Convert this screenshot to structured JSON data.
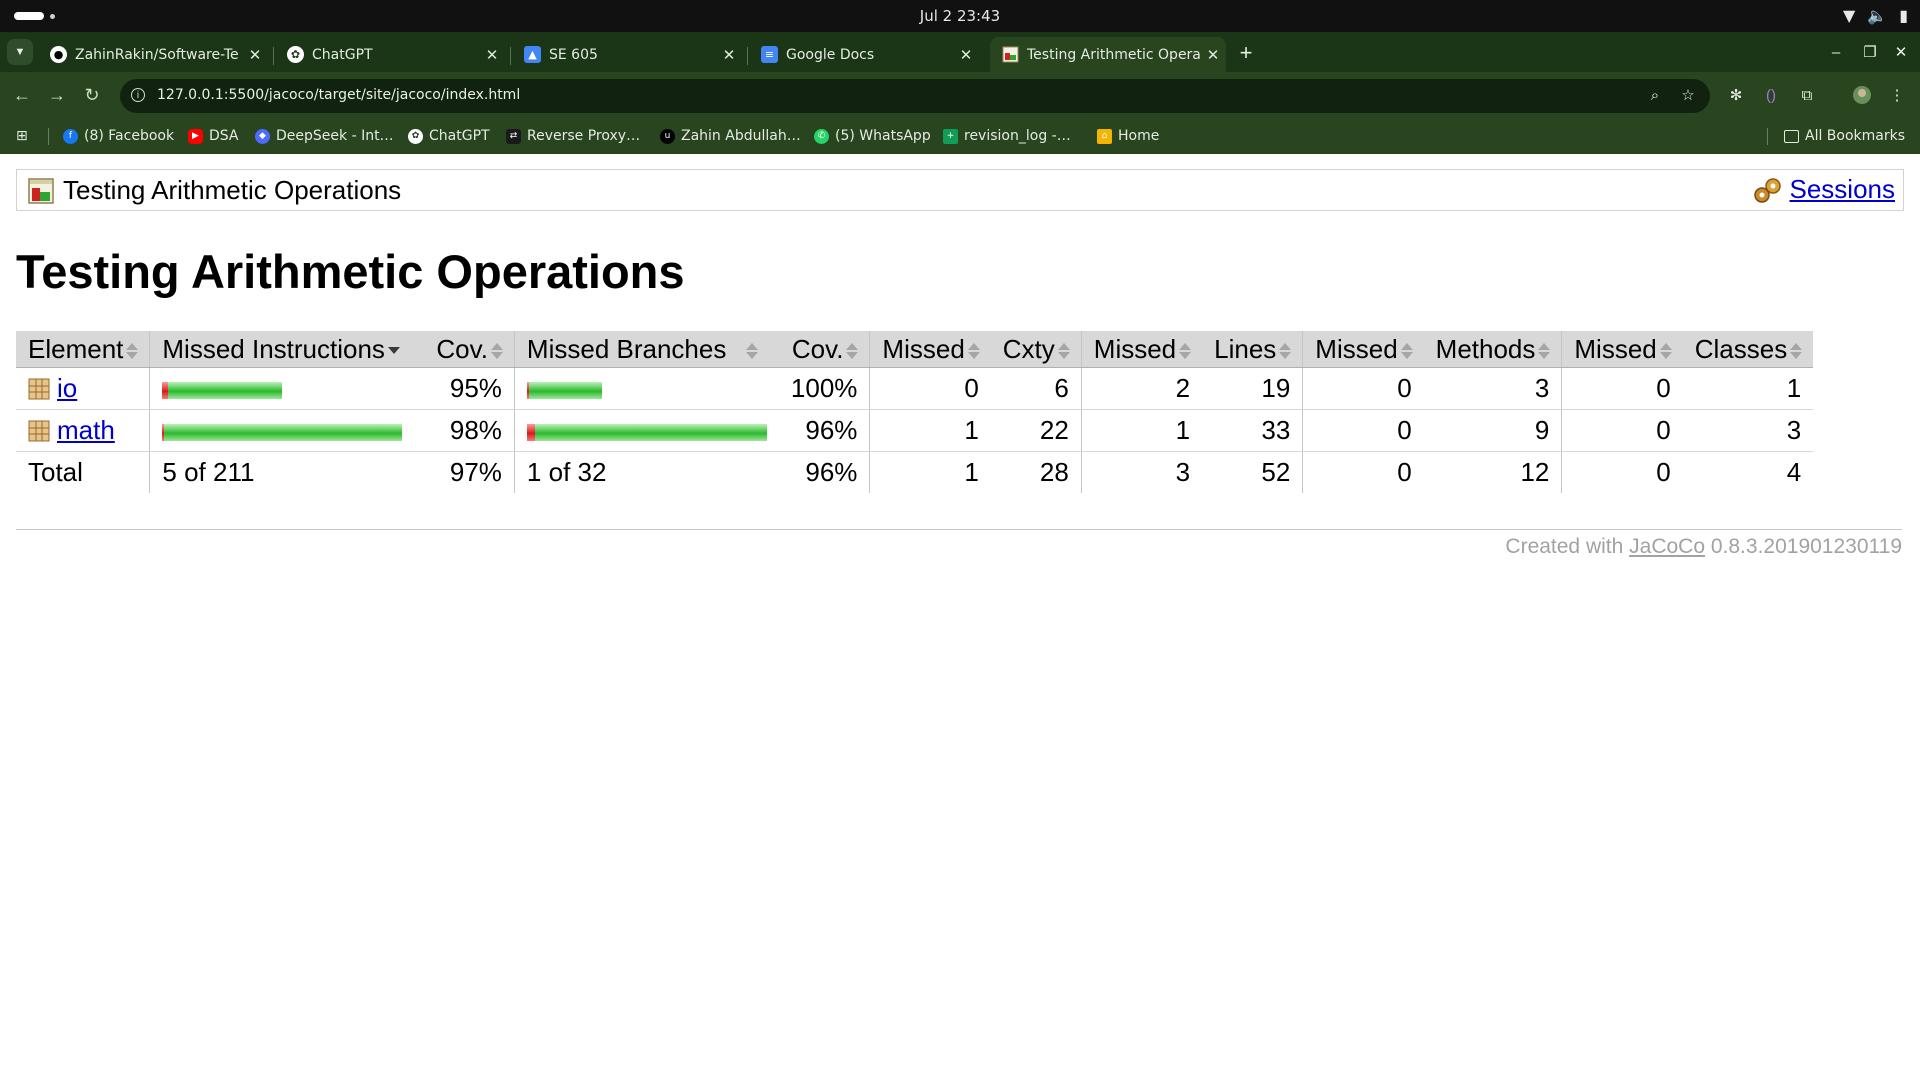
{
  "os": {
    "clock": "Jul 2  23:43"
  },
  "browser": {
    "tabs": [
      {
        "title": "ZahinRakin/Software-Te",
        "icon": "github-icon"
      },
      {
        "title": "ChatGPT",
        "icon": "chatgpt-icon"
      },
      {
        "title": "SE 605",
        "icon": "slides-icon"
      },
      {
        "title": "Google Docs",
        "icon": "docs-icon"
      },
      {
        "title": "Testing Arithmetic Opera",
        "icon": "jacoco-report-icon",
        "active": true
      }
    ],
    "url": "127.0.0.1:5500/jacoco/target/site/jacoco/index.html",
    "bookmarks": [
      {
        "label": "(8) Facebook",
        "icon": "facebook-icon",
        "color": "#1877f2"
      },
      {
        "label": "DSA",
        "icon": "youtube-icon",
        "color": "#ff0000"
      },
      {
        "label": "DeepSeek - Int…",
        "icon": "deepseek-icon",
        "color": "#4d6bfe"
      },
      {
        "label": "ChatGPT",
        "icon": "chatgpt-icon",
        "color": "#ffffff"
      },
      {
        "label": "Reverse Proxy…",
        "icon": "reverse-proxy-icon",
        "color": "#1a1a1a"
      },
      {
        "label": "Zahin Abdullah…",
        "icon": "upwork-icon",
        "color": "#000000"
      },
      {
        "label": "(5) WhatsApp",
        "icon": "whatsapp-icon",
        "color": "#25d366"
      },
      {
        "label": "revision_log -…",
        "icon": "sheets-icon",
        "color": "#0f9d58"
      },
      {
        "label": "Home",
        "icon": "home-icon",
        "color": "#f4b400"
      }
    ],
    "all_bookmarks": "All Bookmarks"
  },
  "report": {
    "breadcrumb": "Testing Arithmetic Operations",
    "sessions": "Sessions",
    "title": "Testing Arithmetic Operations",
    "headers": {
      "element": "Element",
      "missed_instructions": "Missed Instructions",
      "cov": "Cov.",
      "missed_branches": "Missed Branches",
      "cov2": "Cov.",
      "missed_cxty": "Missed",
      "cxty": "Cxty",
      "missed_lines": "Missed",
      "lines": "Lines",
      "missed_methods": "Missed",
      "methods": "Methods",
      "missed_classes": "Missed",
      "classes": "Classes"
    },
    "rows": [
      {
        "name": "io",
        "instr_missed": 5,
        "instr_total": 105,
        "instr_cov": "95%",
        "branch_missed": 0,
        "branch_total": 10,
        "branch_cov": "100%",
        "missed_cxty": "0",
        "cxty": "6",
        "missed_lines": "2",
        "lines": "19",
        "missed_methods": "0",
        "methods": "3",
        "missed_classes": "0",
        "classes": "1"
      },
      {
        "name": "math",
        "instr_missed": 0,
        "instr_total": 210,
        "instr_cov": "98%",
        "branch_missed": 1,
        "branch_total": 32,
        "branch_cov": "96%",
        "missed_cxty": "1",
        "cxty": "22",
        "missed_lines": "1",
        "lines": "33",
        "missed_methods": "0",
        "methods": "9",
        "missed_classes": "0",
        "classes": "3"
      }
    ],
    "total": {
      "label": "Total",
      "instructions": "5 of 211",
      "instr_cov": "97%",
      "branches": "1 of 32",
      "branch_cov": "96%",
      "missed_cxty": "1",
      "cxty": "28",
      "missed_lines": "3",
      "lines": "52",
      "missed_methods": "0",
      "methods": "12",
      "missed_classes": "0",
      "classes": "4"
    },
    "footer": {
      "prefix": "Created with",
      "link": "JaCoCo",
      "version": "0.8.3.201901230119"
    }
  }
}
